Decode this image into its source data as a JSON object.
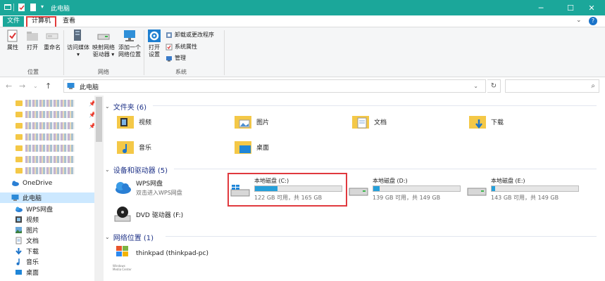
{
  "window": {
    "title": "此电脑"
  },
  "ribbon_tabs": {
    "file": "文件",
    "computer": "计算机",
    "view": "查看"
  },
  "ribbon": {
    "location_group": {
      "label": "位置",
      "buttons": [
        "属性",
        "打开",
        "重命名"
      ]
    },
    "network_group": {
      "label": "网络",
      "access_media": "访问媒体",
      "map_drive_line1": "映射网络",
      "map_drive_line2": "驱动器",
      "add_location_line1": "添加一个",
      "add_location_line2": "网络位置"
    },
    "system_group": {
      "label": "系统",
      "open_settings_line1": "打开",
      "open_settings_line2": "设置",
      "uninstall": "卸载或更改程序",
      "system_properties": "系统属性",
      "manage": "管理"
    }
  },
  "address": {
    "crumb": "此电脑",
    "search_placeholder": ""
  },
  "nav": {
    "onedrive": "OneDrive",
    "this_pc": "此电脑",
    "children": [
      "WPS网盘",
      "视频",
      "图片",
      "文档",
      "下载",
      "音乐",
      "桌面"
    ]
  },
  "content": {
    "folders_header": "文件夹 (6)",
    "folders": [
      "视频",
      "图片",
      "文档",
      "下载",
      "音乐",
      "桌面"
    ],
    "devices_header": "设备和驱动器 (5)",
    "wps": {
      "name": "WPS网盘",
      "sub": "双击进入WPS网盘"
    },
    "drives": [
      {
        "name": "本地磁盘 (C:)",
        "info": "122 GB 可用，共 165 GB",
        "used_fraction": 0.26
      },
      {
        "name": "本地磁盘 (D:)",
        "info": "139 GB 可用，共 149 GB",
        "used_fraction": 0.07
      },
      {
        "name": "本地磁盘 (E:)",
        "info": "143 GB 可用，共 149 GB",
        "used_fraction": 0.04
      }
    ],
    "dvd": {
      "name": "DVD 驱动器 (F:)"
    },
    "network_header": "网络位置 (1)",
    "network_item": {
      "name": "thinkpad (thinkpad-pc)",
      "logo_text": "Windows Media Center"
    }
  },
  "colors": {
    "titlebar": "#1ba79a",
    "drive_bar": "#26a0da",
    "highlight": "#e0393e"
  }
}
